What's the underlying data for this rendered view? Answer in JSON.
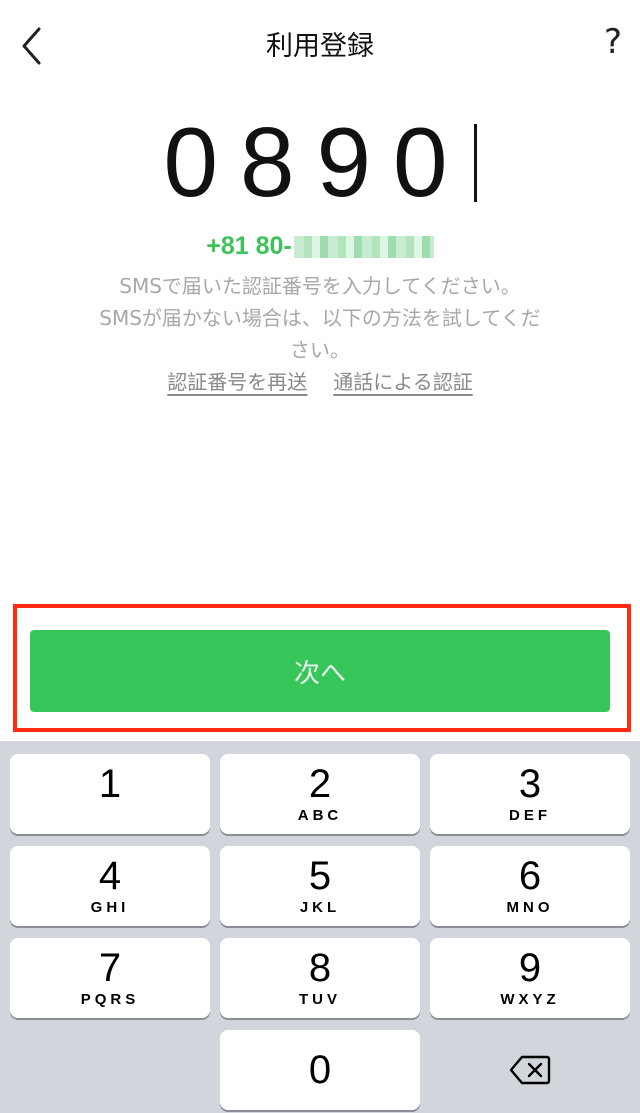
{
  "nav": {
    "title": "利用登録",
    "help_label": "?"
  },
  "code": {
    "value": "0890"
  },
  "phone": {
    "prefix": "+81 80-"
  },
  "description": {
    "line1": "SMSで届いた認証番号を入力してください。",
    "line2": "SMSが届かない場合は、以下の方法を試してください。"
  },
  "links": {
    "resend": "認証番号を再送",
    "call": "通話による認証"
  },
  "next_button": {
    "label": "次へ"
  },
  "colors": {
    "accent_green": "#37c65a",
    "highlight_red": "#ff2a10"
  },
  "keypad": {
    "keys": [
      {
        "num": "1",
        "letters": ""
      },
      {
        "num": "2",
        "letters": "ABC"
      },
      {
        "num": "3",
        "letters": "DEF"
      },
      {
        "num": "4",
        "letters": "GHI"
      },
      {
        "num": "5",
        "letters": "JKL"
      },
      {
        "num": "6",
        "letters": "MNO"
      },
      {
        "num": "7",
        "letters": "PQRS"
      },
      {
        "num": "8",
        "letters": "TUV"
      },
      {
        "num": "9",
        "letters": "WXYZ"
      },
      {
        "num": "0",
        "letters": ""
      }
    ],
    "backspace_icon": "backspace-icon"
  }
}
